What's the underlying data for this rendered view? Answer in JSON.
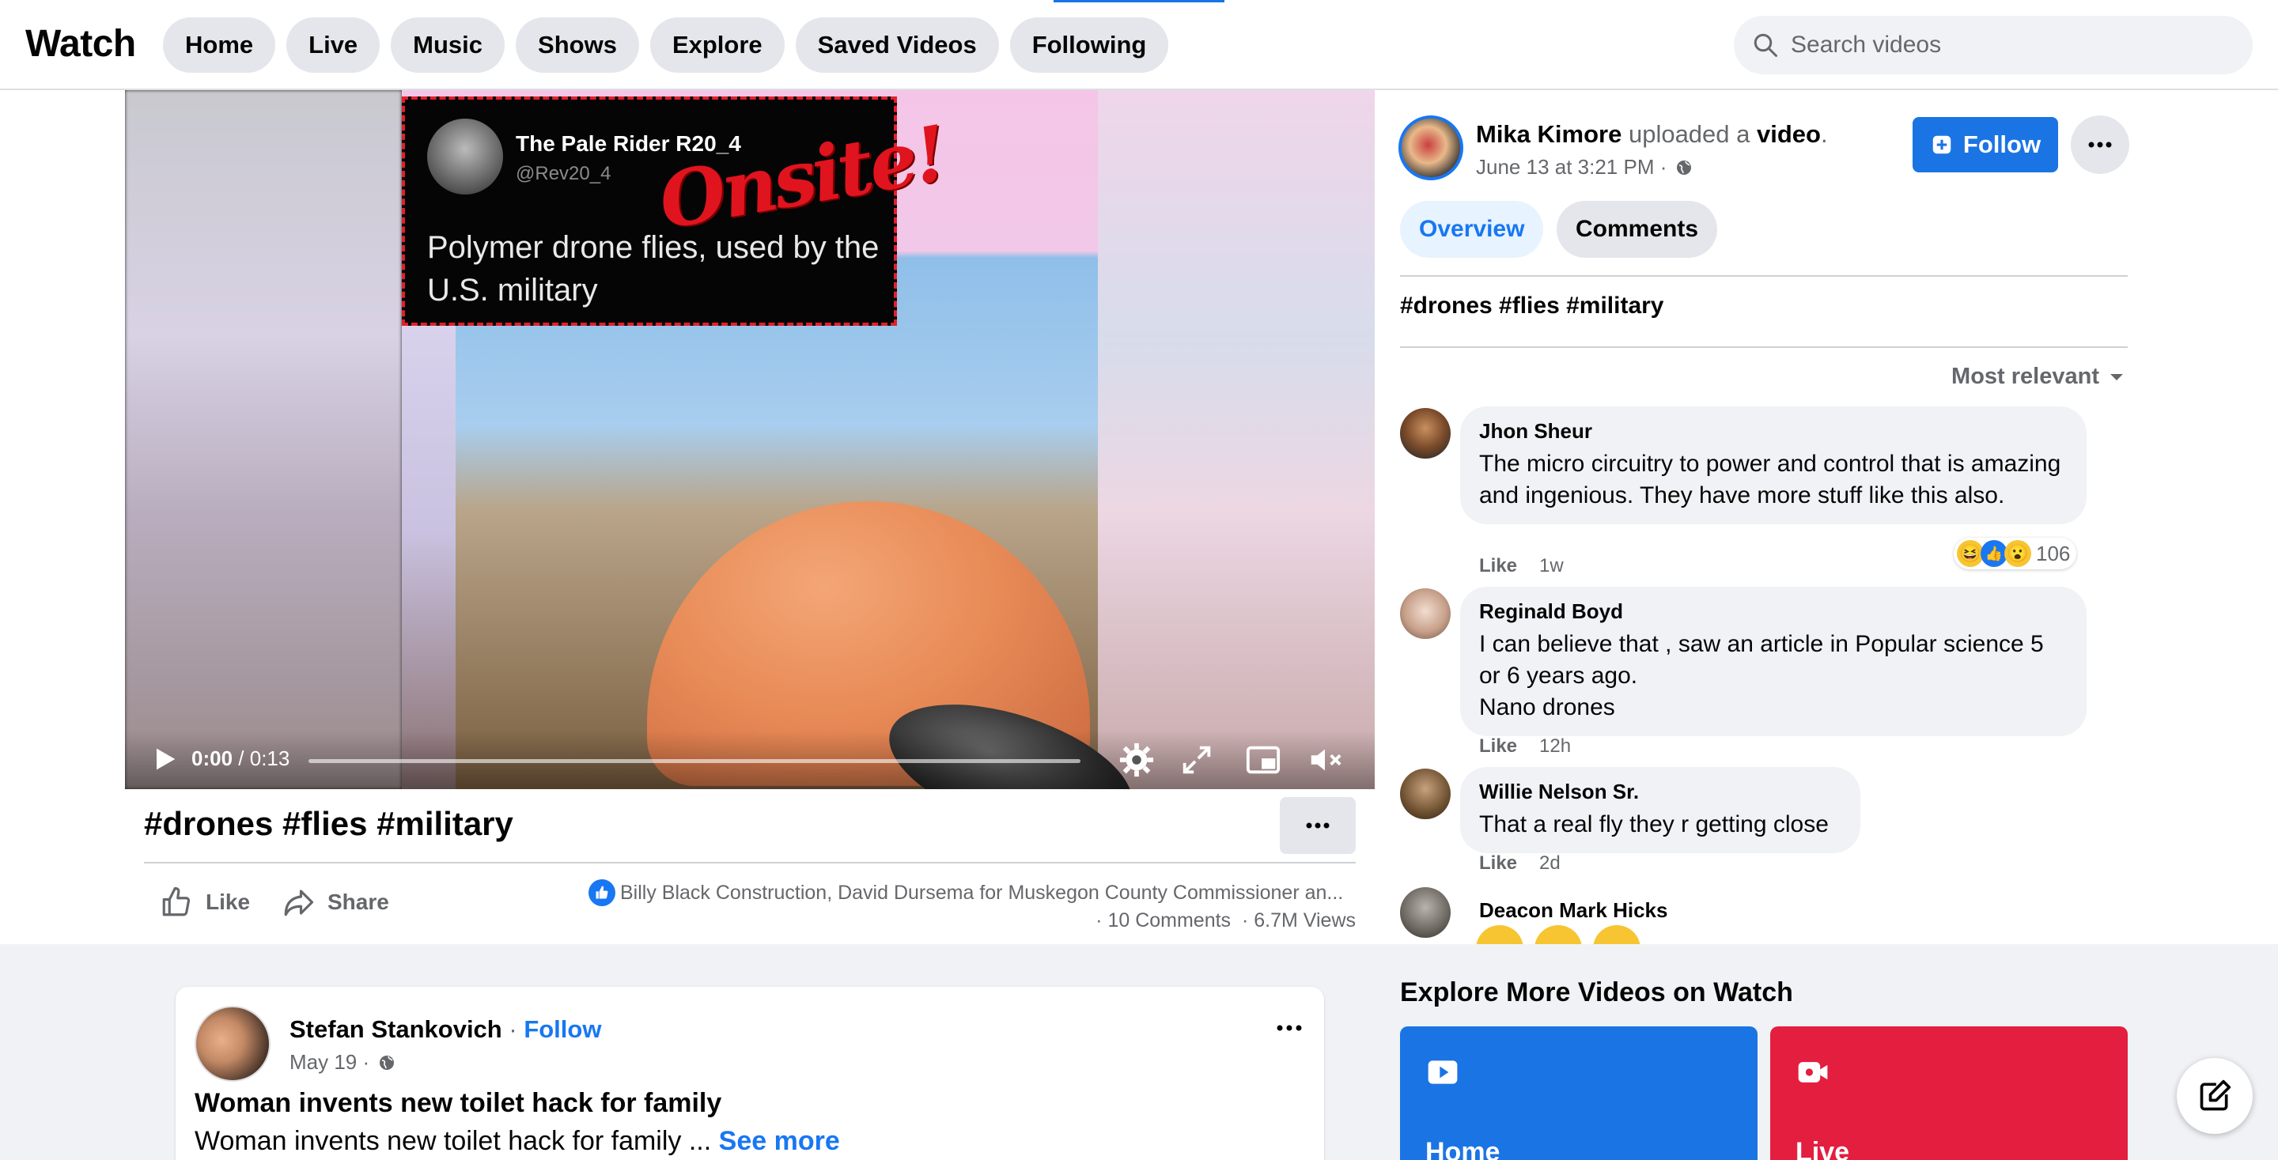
{
  "header": {
    "brand": "Watch",
    "nav": [
      "Home",
      "Live",
      "Music",
      "Shows",
      "Explore",
      "Saved Videos",
      "Following"
    ],
    "search_placeholder": "Search videos"
  },
  "video": {
    "tweet_name": "The Pale Rider R20_4",
    "tweet_handle": "@Rev20_4",
    "tweet_text": "Polymer drone flies, used by the U.S. military",
    "watermark": "Onsite!",
    "current_time": "0:00",
    "duration": "/ 0:13",
    "progress": 0
  },
  "post": {
    "title": "#drones #flies #military",
    "like_label": "Like",
    "share_label": "Share",
    "reactors": "Billy Black Construction, David Dursema for Muskegon County Commissioner an...",
    "comments": "· 10 Comments",
    "views": "· 6.7M Views"
  },
  "sidebar": {
    "uploader_name": "Mika Kimore",
    "uploader_action": " uploaded a ",
    "uploader_object": "video",
    "uploader_end": ".",
    "date": "June 13 at 3:21 PM ·",
    "follow_label": "Follow",
    "tabs": [
      "Overview",
      "Comments"
    ],
    "tags": "#drones #flies #military",
    "sort_label": "Most relevant",
    "comments": [
      {
        "author": "Jhon Sheur",
        "text": "The micro circuitry to power and control that is amazing and ingenious. They have more stuff like this also.",
        "like": "Like",
        "time": "1w",
        "reactions": "106"
      },
      {
        "author": "Reginald Boyd",
        "text": "I can believe that , saw an article in Popular science 5 or 6 years ago.\nNano drones",
        "like": "Like",
        "time": "12h"
      },
      {
        "author": "Willie Nelson Sr.",
        "text": "That a real fly they r getting close",
        "like": "Like",
        "time": "2d"
      },
      {
        "author": "Deacon Mark Hicks"
      }
    ]
  },
  "feed": {
    "author": "Stefan Stankovich",
    "separator": " · ",
    "follow": "Follow",
    "date": "May 19 ·",
    "title": "Woman invents new toilet hack for family",
    "body": "Woman invents new toilet hack for family ... ",
    "see_more": "See more"
  },
  "explore": {
    "title": "Explore More Videos on Watch",
    "cards": [
      {
        "label": "Home",
        "color": "#1b74e4"
      },
      {
        "label": "Live",
        "color": "#e41e3f"
      }
    ]
  }
}
